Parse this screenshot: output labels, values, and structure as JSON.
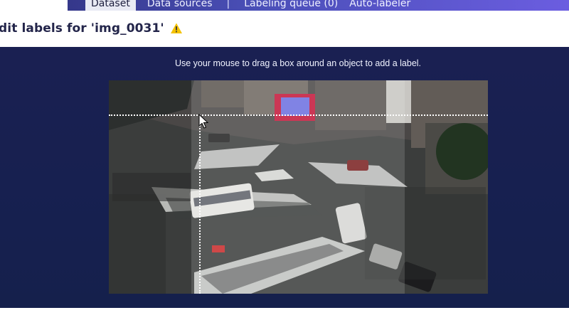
{
  "nav": {
    "tabs": [
      "Dataset",
      "Data sources",
      "Labeling queue (0)",
      "Auto-labeler"
    ],
    "active_tab": "Dataset",
    "separator": "|"
  },
  "header": {
    "title": "dit labels for 'img_0031'",
    "warning_icon": "warning-triangle-icon",
    "warning_color": "#f4c200"
  },
  "editor": {
    "instructions": "Use your mouse to drag a box around an object to add a label.",
    "background": "#1a2052",
    "crosshair_color": "#ffffff",
    "cursor_icon": "pointer-cursor-icon"
  }
}
